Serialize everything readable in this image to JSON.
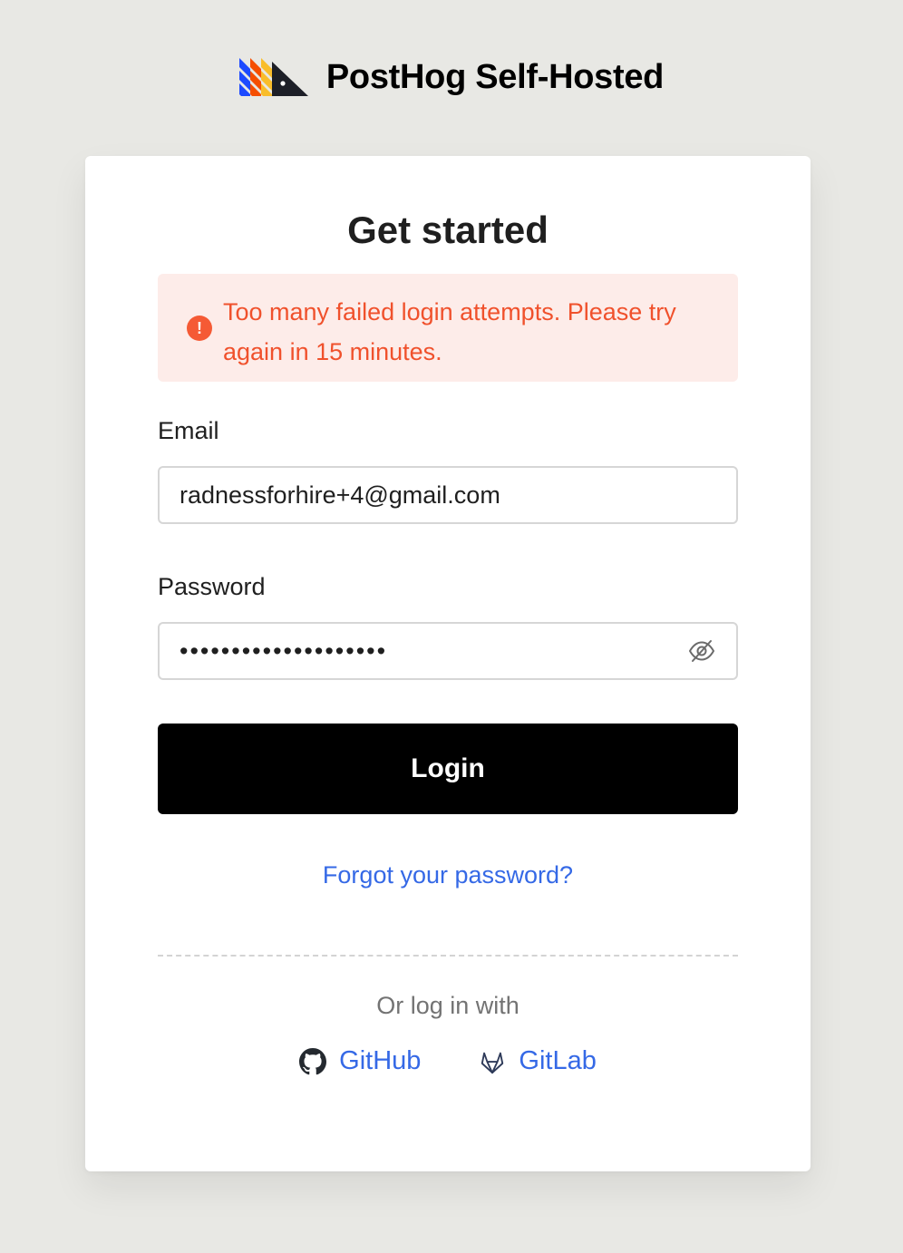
{
  "brand": {
    "name": "PostHog Self-Hosted",
    "logo_icon": "posthog-hedgehog-logo"
  },
  "login": {
    "title": "Get started",
    "error_message": "Too many failed login attempts. Please try again in 15 minutes.",
    "error_icon_glyph": "!",
    "email_label": "Email",
    "email_value": "radnessforhire+4@gmail.com",
    "password_label": "Password",
    "password_value": "••••••••••••••••••••",
    "submit_label": "Login",
    "forgot_label": "Forgot your password?",
    "alt_login_label": "Or log in with",
    "providers": [
      {
        "label": "GitHub",
        "icon": "github-icon"
      },
      {
        "label": "GitLab",
        "icon": "gitlab-icon"
      }
    ]
  },
  "colors": {
    "page_background": "#e8e8e4",
    "error_background": "#fdece9",
    "error_text": "#f0512c",
    "link": "#3569e6",
    "button": "#000000"
  }
}
